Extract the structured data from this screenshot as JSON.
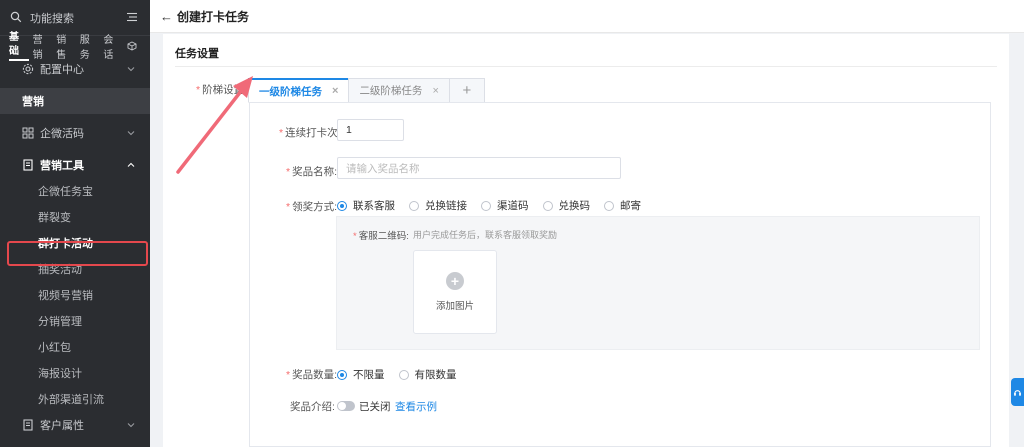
{
  "sidebar": {
    "search_label": "功能搜索",
    "tabs": [
      "基础",
      "营销",
      "销售",
      "服务",
      "会话"
    ],
    "config_center": "配置中心",
    "section_title": "营销",
    "wecom_code": "企微活码",
    "marketing_tools": "营销工具",
    "sub_items": [
      "企微任务宝",
      "群裂变",
      "群打卡活动",
      "抽奖活动",
      "视频号营销",
      "分销管理",
      "小红包",
      "海报设计",
      "外部渠道引流"
    ],
    "active_index": 2,
    "customer_attr": "客户属性"
  },
  "header": {
    "back_label": "←",
    "title": "创建打卡任务"
  },
  "form": {
    "section_title": "任务设置",
    "ladder_label": "阶梯设置:",
    "tabs": [
      {
        "label": "一级阶梯任务",
        "close": "×"
      },
      {
        "label": "二级阶梯任务",
        "close": "×"
      }
    ],
    "add_tab": "+",
    "consecutive_label": "连续打卡次数:",
    "consecutive_value": "1",
    "prize_name_label": "奖品名称:",
    "prize_name_placeholder": "请输入奖品名称",
    "claim_method_label": "领奖方式:",
    "claim_options": [
      "联系客服",
      "兑换链接",
      "渠道码",
      "兑换码",
      "邮寄"
    ],
    "claim_selected": 0,
    "qr_label": "客服二维码:",
    "qr_hint": "用户完成任务后，联系客服领取奖励",
    "upload_label": "添加图片",
    "upload_icon": "+",
    "quantity_label": "奖品数量:",
    "quantity_options": [
      "不限量",
      "有限数量"
    ],
    "quantity_selected": 0,
    "intro_label": "奖品介绍:",
    "intro_status": "已关闭",
    "intro_link": "查看示例",
    "intro_enabled": false
  },
  "colors": {
    "accent": "#1e88e5",
    "sidebar_bg": "#2b2d31",
    "highlight": "#e5484d",
    "required": "#f56c6c"
  }
}
